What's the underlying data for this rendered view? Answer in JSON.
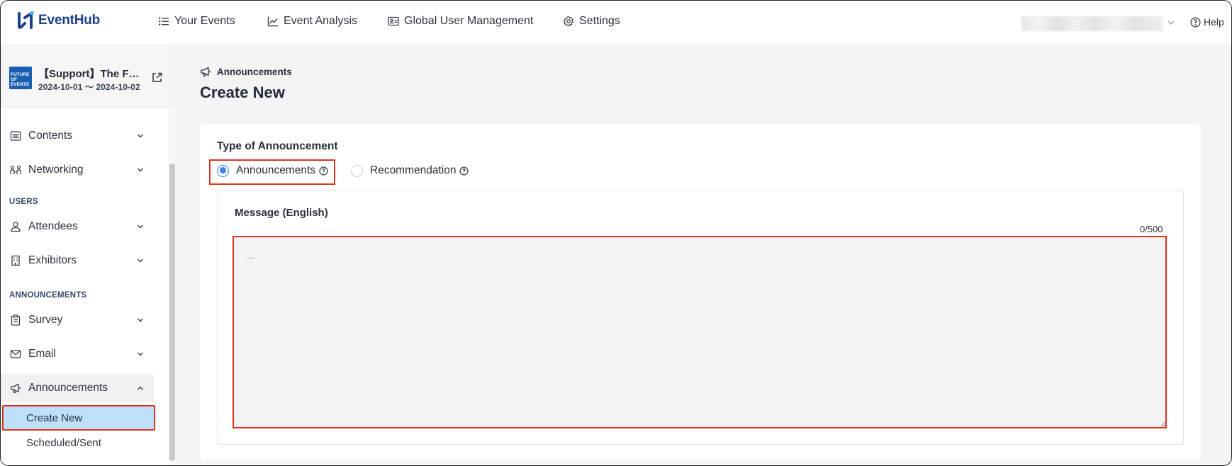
{
  "app": {
    "name": "EventHub",
    "accent": "#3b82f6",
    "highlight": "#e0321f"
  },
  "topnav": {
    "items": [
      {
        "label": "Your Events",
        "icon": "list-icon"
      },
      {
        "label": "Event Analysis",
        "icon": "line-chart-icon"
      },
      {
        "label": "Global User Management",
        "icon": "id-card-icon"
      },
      {
        "label": "Settings",
        "icon": "gear-icon"
      }
    ],
    "help_label": "Help"
  },
  "event": {
    "title": "【Support】The Future of Events",
    "dates": "2024-10-01 ～ 2024-10-02",
    "thumb_text": "FUTURE OF EVENTS"
  },
  "sidebar": {
    "items": [
      {
        "label": "Contents",
        "icon": "document-list-icon"
      },
      {
        "label": "Networking",
        "icon": "networking-icon"
      }
    ],
    "section_users": "USERS",
    "users_items": [
      {
        "label": "Attendees",
        "icon": "user-icon"
      },
      {
        "label": "Exhibitors",
        "icon": "building-icon"
      }
    ],
    "section_announcements": "ANNOUNCEMENTS",
    "announcement_items": [
      {
        "label": "Survey",
        "icon": "clipboard-icon"
      },
      {
        "label": "Email",
        "icon": "mail-icon"
      },
      {
        "label": "Announcements",
        "icon": "megaphone-icon"
      }
    ],
    "sub_items": [
      {
        "label": "Create New"
      },
      {
        "label": "Scheduled/Sent"
      }
    ]
  },
  "main": {
    "breadcrumb": "Announcements",
    "title": "Create New",
    "type_label": "Type of Announcement",
    "types": [
      {
        "label": "Announcements",
        "selected": true
      },
      {
        "label": "Recommendation",
        "selected": false
      }
    ],
    "message_label": "Message (English)",
    "counter": "0/500",
    "message_placeholder": "...",
    "message_value": ""
  }
}
